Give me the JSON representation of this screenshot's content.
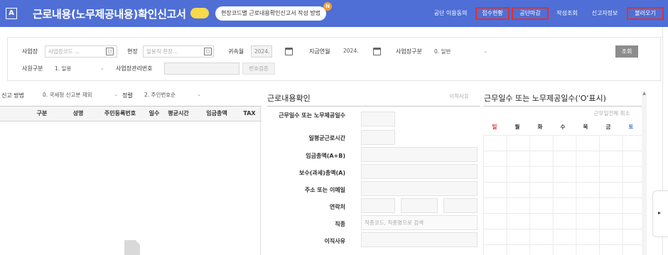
{
  "header": {
    "logo_label": "A",
    "title": "근로내용(노무제공내용)확인신고서",
    "guide_label": "현장코드별 근로내용확인신고서 작성 방법",
    "new_badge": "N",
    "buttons": [
      "공단 이용동의",
      "접수현황",
      "공단마감",
      "작성조회",
      "신고자정보",
      "불러오기"
    ]
  },
  "search": {
    "site_label": "사업장",
    "site_placeholder": "사업장코드 ...",
    "field_label": "현장",
    "field_placeholder": "일용직 현장...",
    "belong_month_label": "귀속월",
    "belong_month_value": "2024.",
    "pay_year_label": "지급연월",
    "pay_year_value": "2024.",
    "biz_type_label": "사업장구분",
    "biz_type_value": "0. 일반",
    "query_button": "조회",
    "emp_type_label": "사원구분",
    "emp_type_value": "1. 일용",
    "mgmt_no_label": "사업장관리번호",
    "verify_button": "번호검증"
  },
  "left": {
    "report_method_label": "신고 방법",
    "report_method_value": "0. 국세청 신고분 제외",
    "sort_label": "정렬",
    "sort_value": "2. 주민번호순",
    "columns": [
      "구분",
      "성명",
      "주민등록번호",
      "일수",
      "평균시간",
      "임금총액",
      "TAX"
    ]
  },
  "middle": {
    "title": "근로내용확인",
    "reason_button": "이직사유",
    "rows": [
      {
        "label": "근무일수 또는 노무제공일수"
      },
      {
        "label": "일평균근로시간"
      },
      {
        "label": "임금총액(A+B)"
      },
      {
        "label": "보수(과세)총액(A)"
      },
      {
        "label": "주소 또는 이메일"
      },
      {
        "label": "연락처"
      },
      {
        "label": "직종",
        "placeholder": "직종코드, 직종명으로 검색"
      },
      {
        "label": "이직사유"
      }
    ]
  },
  "right": {
    "title": "근무일수 또는 노무제공일수('O'표시)",
    "clear_all_button": "근무일전체 취소",
    "weekdays": [
      "일",
      "월",
      "화",
      "수",
      "목",
      "금",
      "토"
    ],
    "weekday_colors": {
      "sunday": "#e03030",
      "saturday": "#3a6bd8",
      "weekday": "#333333"
    }
  },
  "theme": {
    "header_bg": "#4f6fd6",
    "highlight_border": "#e03030",
    "toggle": "#f7d949"
  }
}
